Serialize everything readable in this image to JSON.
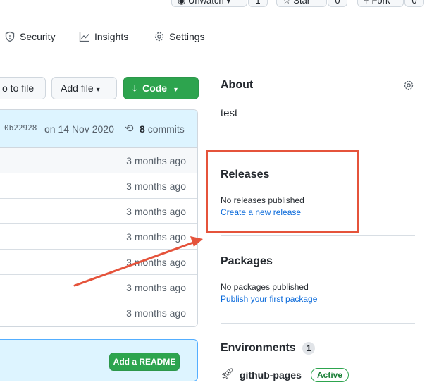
{
  "header": {
    "unwatch_label": "Unwatch",
    "unwatch_count": "1",
    "star_label": "Star",
    "star_count": "0",
    "fork_label": "Fork",
    "fork_count": "0"
  },
  "tabs": [
    {
      "label": "Security",
      "icon": "shield-icon"
    },
    {
      "label": "Insights",
      "icon": "graph-icon"
    },
    {
      "label": "Settings",
      "icon": "gear-icon"
    }
  ],
  "toolbar": {
    "goto_file_label": "o to file",
    "add_file_label": "Add file",
    "code_label": "Code"
  },
  "commit": {
    "hash": "0b22928",
    "date_text": "on 14 Nov 2020",
    "count": "8",
    "count_label": "commits"
  },
  "files": [
    {
      "age": "3 months ago"
    },
    {
      "age": "3 months ago"
    },
    {
      "age": "3 months ago"
    },
    {
      "age": "3 months ago"
    },
    {
      "age": "3 months ago"
    },
    {
      "age": "3 months ago"
    },
    {
      "age": "3 months ago"
    }
  ],
  "readme_button": "Add a README",
  "about": {
    "title": "About",
    "description": "test"
  },
  "releases": {
    "title": "Releases",
    "empty_text": "No releases published",
    "create_link": "Create a new release"
  },
  "packages": {
    "title": "Packages",
    "empty_text": "No packages published",
    "publish_link": "Publish your first package"
  },
  "environments": {
    "title": "Environments",
    "count": "1",
    "items": [
      {
        "name": "github-pages",
        "status": "Active"
      }
    ]
  },
  "colors": {
    "accent_green": "#2da44e",
    "link_blue": "#0969da",
    "highlight_red": "#e5533b"
  }
}
